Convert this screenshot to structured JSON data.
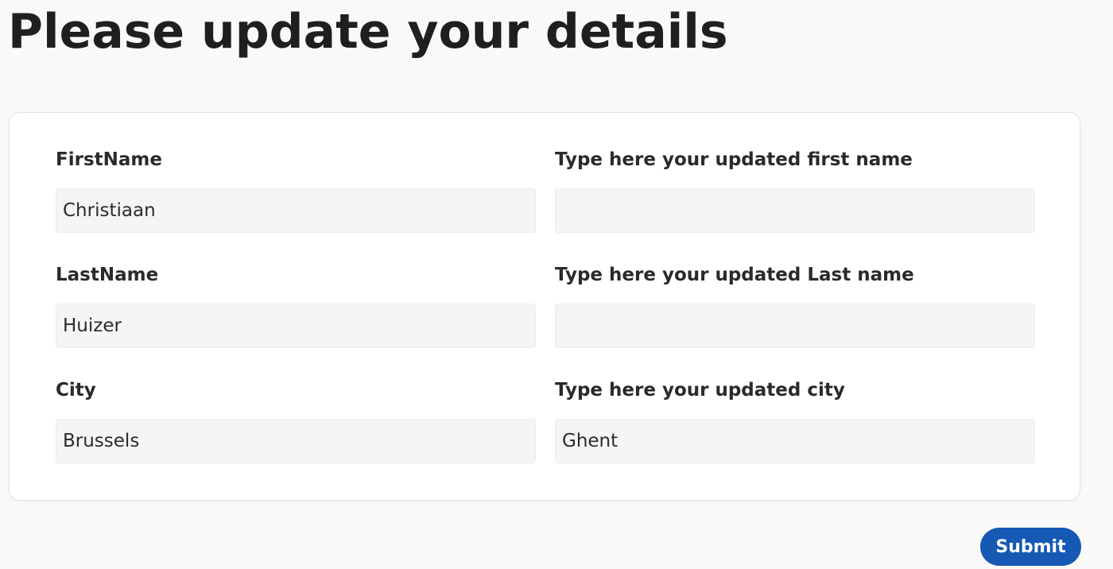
{
  "page": {
    "title": "Please update your details"
  },
  "form": {
    "rows": [
      {
        "current_label": "FirstName",
        "current_value": "Christiaan",
        "update_label": "Type here your updated first name",
        "update_value": ""
      },
      {
        "current_label": "LastName",
        "current_value": "Huizer",
        "update_label": "Type here your updated Last name",
        "update_value": ""
      },
      {
        "current_label": "City",
        "current_value": "Brussels",
        "update_label": "Type here your updated city",
        "update_value": "Ghent"
      }
    ],
    "submit_label": "Submit"
  },
  "colors": {
    "background": "#f9f9f9",
    "card": "#ffffff",
    "input_background": "#f5f5f5",
    "accent": "#1659b4"
  }
}
